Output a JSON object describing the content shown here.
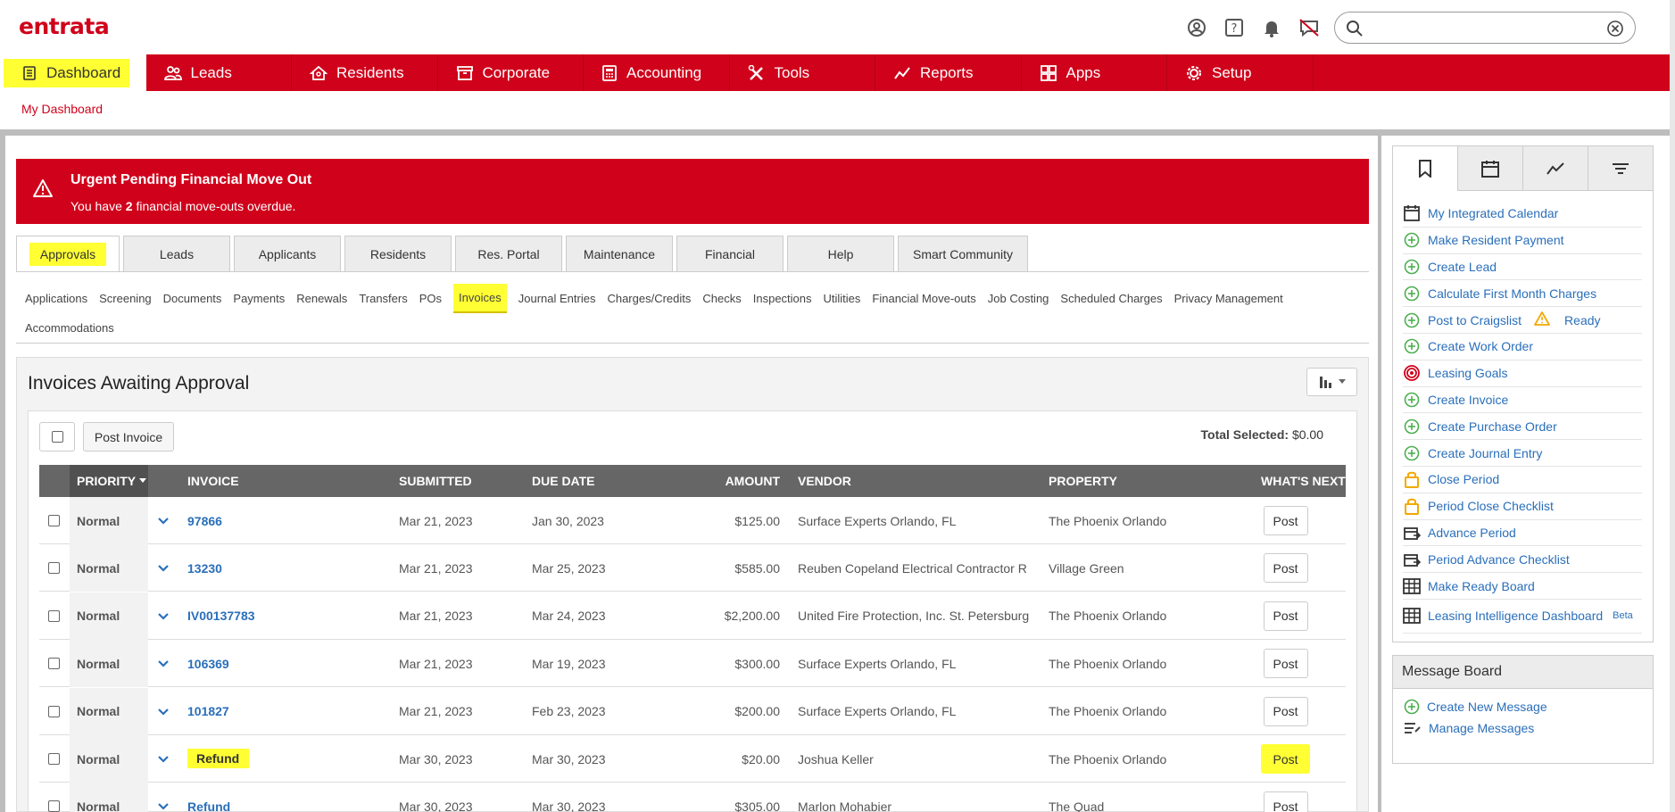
{
  "app": {
    "logo": "entrata"
  },
  "search": {
    "placeholder": ""
  },
  "nav": [
    {
      "label": "Dashboard",
      "icon": "dashboard-icon"
    },
    {
      "label": "Leads",
      "icon": "leads-icon"
    },
    {
      "label": "Residents",
      "icon": "residents-icon"
    },
    {
      "label": "Corporate",
      "icon": "corporate-icon"
    },
    {
      "label": "Accounting",
      "icon": "accounting-icon"
    },
    {
      "label": "Tools",
      "icon": "tools-icon"
    },
    {
      "label": "Reports",
      "icon": "reports-icon"
    },
    {
      "label": "Apps",
      "icon": "apps-icon"
    },
    {
      "label": "Setup",
      "icon": "setup-icon"
    }
  ],
  "subnav": {
    "label": "My Dashboard"
  },
  "alert": {
    "title": "Urgent Pending Financial Move Out",
    "text_prefix": "You have ",
    "count": "2",
    "text_suffix": " financial move-outs overdue."
  },
  "tabs": [
    "Approvals",
    "Leads",
    "Applicants",
    "Residents",
    "Res. Portal",
    "Maintenance",
    "Financial",
    "Help",
    "Smart Community"
  ],
  "subtabs": [
    "Applications",
    "Screening",
    "Documents",
    "Payments",
    "Renewals",
    "Transfers",
    "POs",
    "Invoices",
    "Journal Entries",
    "Charges/Credits",
    "Checks",
    "Inspections",
    "Utilities",
    "Financial Move-outs",
    "Job Costing",
    "Scheduled Charges",
    "Privacy Management",
    "Accommodations"
  ],
  "invoices": {
    "title": "Invoices Awaiting Approval",
    "post_invoice": "Post Invoice",
    "total_selected_label": "Total Selected:",
    "total_selected_value": "$0.00",
    "columns": {
      "priority": "PRIORITY",
      "invoice": "INVOICE",
      "submitted": "SUBMITTED",
      "due": "DUE DATE",
      "amount": "AMOUNT",
      "vendor": "VENDOR",
      "property": "PROPERTY",
      "next": "WHAT'S NEXT"
    },
    "rows": [
      {
        "priority": "Normal",
        "invoice": "97866",
        "submitted": "Mar 21, 2023",
        "due": "Jan 30, 2023",
        "amount": "$125.00",
        "vendor": "Surface Experts Orlando, FL",
        "property": "The Phoenix Orlando",
        "action": "Post"
      },
      {
        "priority": "Normal",
        "invoice": "13230",
        "submitted": "Mar 21, 2023",
        "due": "Mar 25, 2023",
        "amount": "$585.00",
        "vendor": "Reuben Copeland Electrical Contractor R",
        "property": "Village Green",
        "action": "Post"
      },
      {
        "priority": "Normal",
        "invoice": "IV00137783",
        "submitted": "Mar 21, 2023",
        "due": "Mar 24, 2023",
        "amount": "$2,200.00",
        "vendor": "United Fire Protection, Inc. St. Petersburg",
        "property": "The Phoenix Orlando",
        "action": "Post"
      },
      {
        "priority": "Normal",
        "invoice": "106369",
        "submitted": "Mar 21, 2023",
        "due": "Mar 19, 2023",
        "amount": "$300.00",
        "vendor": "Surface Experts Orlando, FL",
        "property": "The Phoenix Orlando",
        "action": "Post"
      },
      {
        "priority": "Normal",
        "invoice": "101827",
        "submitted": "Mar 21, 2023",
        "due": "Feb 23, 2023",
        "amount": "$200.00",
        "vendor": "Surface Experts Orlando, FL",
        "property": "The Phoenix Orlando",
        "action": "Post"
      },
      {
        "priority": "Normal",
        "invoice": "Refund",
        "submitted": "Mar 30, 2023",
        "due": "Mar 30, 2023",
        "amount": "$20.00",
        "vendor": "Joshua Keller",
        "property": "The Phoenix Orlando",
        "action": "Post"
      },
      {
        "priority": "Normal",
        "invoice": "Refund",
        "submitted": "Mar 30, 2023",
        "due": "Mar 30, 2023",
        "amount": "$305.00",
        "vendor": "Marlon Mohabier",
        "property": "The Quad",
        "action": "Post"
      }
    ]
  },
  "sidebar": {
    "items": [
      {
        "label": "My Integrated Calendar",
        "icon": "calendar-icon"
      },
      {
        "label": "Make Resident Payment",
        "icon": "plus-circle-icon"
      },
      {
        "label": "Create Lead",
        "icon": "plus-circle-icon"
      },
      {
        "label": "Calculate First Month Charges",
        "icon": "plus-circle-icon"
      },
      {
        "label": "Post to Craigslist",
        "icon": "plus-circle-icon",
        "badge": "Ready"
      },
      {
        "label": "Create Work Order",
        "icon": "plus-circle-icon"
      },
      {
        "label": "Leasing Goals",
        "icon": "target-icon"
      },
      {
        "label": "Create Invoice",
        "icon": "plus-circle-icon"
      },
      {
        "label": "Create Purchase Order",
        "icon": "plus-circle-icon"
      },
      {
        "label": "Create Journal Entry",
        "icon": "plus-circle-icon"
      },
      {
        "label": "Close Period",
        "icon": "lock-icon"
      },
      {
        "label": "Period Close Checklist",
        "icon": "lock-icon"
      },
      {
        "label": "Advance Period",
        "icon": "advance-icon"
      },
      {
        "label": "Period Advance Checklist",
        "icon": "advance-icon"
      },
      {
        "label": "Make Ready Board",
        "icon": "grid-icon"
      },
      {
        "label": "Leasing Intelligence Dashboard",
        "icon": "grid-icon",
        "sup": "Beta"
      }
    ],
    "message_board": {
      "title": "Message Board",
      "create": "Create New Message",
      "manage": "Manage Messages"
    }
  },
  "colors": {
    "brand": "#d0021b",
    "highlight": "#ffff33",
    "link": "#2a6fba"
  }
}
